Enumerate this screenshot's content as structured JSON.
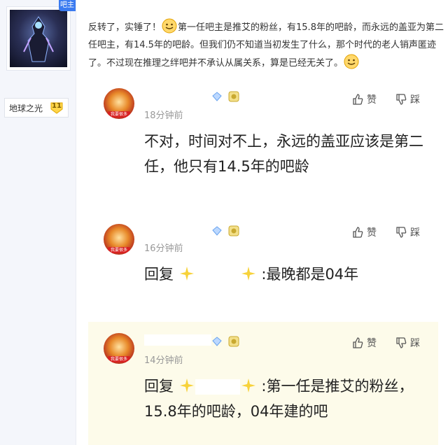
{
  "sidebar": {
    "owner_badge": "吧主",
    "username": "地球之光",
    "level": "11"
  },
  "post": {
    "seg1": "反转了，实锤了！",
    "seg2": "第一任吧主是推艾的粉丝，有15.8年的吧龄，而永远的盖亚为第二任吧主，有14.5年的吧龄。但我们仍不知道当初发生了什么，那个时代的老人销声匿迹了。不过现在推理之绊吧并不承认从属关系，算是已经无关了。",
    "emoji_icon": "smiley-emoji-icon"
  },
  "replies": [
    {
      "time": "18分钟前",
      "content": "不对，时间对不上，永远的盖亚应该是第二任，他只有14.5年的吧龄",
      "like": "赞",
      "dislike": "踩",
      "avatar_tag": "我要很多"
    },
    {
      "time": "16分钟前",
      "reply_prefix": "回复",
      "content": ":最晚都是04年",
      "like": "赞",
      "dislike": "踩",
      "avatar_tag": "我要很多"
    },
    {
      "time": "14分钟前",
      "reply_prefix": "回复",
      "content": ":第一任是推艾的粉丝，15.8年的吧龄，04年建的吧",
      "like": "赞",
      "dislike": "踩",
      "avatar_tag": "我要很多"
    }
  ],
  "colors": {
    "accent": "#3b7bf0",
    "highlight_bg": "#fdfbea",
    "sidebar_bg": "#f4f6fb"
  }
}
